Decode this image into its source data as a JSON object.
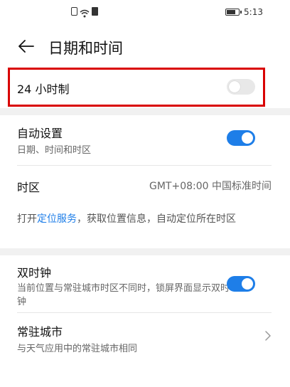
{
  "status_bar": {
    "time": "5:13"
  },
  "header": {
    "title": "日期和时间"
  },
  "twenty_four_hour": {
    "label": "24 小时制",
    "enabled": false
  },
  "auto_setting": {
    "title": "自动设置",
    "subtitle": "日期、时间和时区",
    "enabled": true
  },
  "timezone": {
    "label": "时区",
    "value": "GMT+08:00 中国标准时间"
  },
  "location_note": {
    "prefix": "打开",
    "link": "定位服务",
    "suffix": "，获取位置信息，自动定位所在时区"
  },
  "dual_clock": {
    "title": "双时钟",
    "subtitle": "当前位置与常驻城市时区不同时，锁屏界面显示双时钟",
    "enabled": true
  },
  "home_city": {
    "title": "常驻城市",
    "subtitle": "与天气应用中的常驻城市相同"
  },
  "colors": {
    "accent": "#1e7ee8",
    "highlight": "#d90000"
  }
}
